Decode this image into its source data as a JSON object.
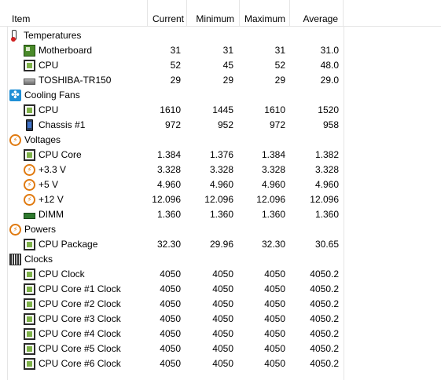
{
  "columns": {
    "item": "Item",
    "current": "Current",
    "minimum": "Minimum",
    "maximum": "Maximum",
    "average": "Average"
  },
  "groups": [
    {
      "label": "Temperatures",
      "icon": "thermometer-icon",
      "rows": [
        {
          "label": "Motherboard",
          "icon": "motherboard-icon",
          "current": "31",
          "min": "31",
          "max": "31",
          "avg": "31.0"
        },
        {
          "label": "CPU",
          "icon": "cpu-chip-icon",
          "current": "52",
          "min": "45",
          "max": "52",
          "avg": "48.0"
        },
        {
          "label": "TOSHIBA-TR150",
          "icon": "drive-icon",
          "current": "29",
          "min": "29",
          "max": "29",
          "avg": "29.0"
        }
      ]
    },
    {
      "label": "Cooling Fans",
      "icon": "fan-icon",
      "rows": [
        {
          "label": "CPU",
          "icon": "cpu-chip-icon",
          "current": "1610",
          "min": "1445",
          "max": "1610",
          "avg": "1520"
        },
        {
          "label": "Chassis #1",
          "icon": "chassis-icon",
          "current": "972",
          "min": "952",
          "max": "972",
          "avg": "958"
        }
      ]
    },
    {
      "label": "Voltages",
      "icon": "voltage-bolt-icon",
      "rows": [
        {
          "label": "CPU Core",
          "icon": "cpu-chip-icon",
          "current": "1.384",
          "min": "1.376",
          "max": "1.384",
          "avg": "1.382"
        },
        {
          "label": "+3.3 V",
          "icon": "voltage-bolt-icon",
          "current": "3.328",
          "min": "3.328",
          "max": "3.328",
          "avg": "3.328"
        },
        {
          "label": "+5 V",
          "icon": "voltage-bolt-icon",
          "current": "4.960",
          "min": "4.960",
          "max": "4.960",
          "avg": "4.960"
        },
        {
          "label": "+12 V",
          "icon": "voltage-bolt-icon",
          "current": "12.096",
          "min": "12.096",
          "max": "12.096",
          "avg": "12.096"
        },
        {
          "label": "DIMM",
          "icon": "dimm-icon",
          "current": "1.360",
          "min": "1.360",
          "max": "1.360",
          "avg": "1.360"
        }
      ]
    },
    {
      "label": "Powers",
      "icon": "voltage-bolt-icon",
      "rows": [
        {
          "label": "CPU Package",
          "icon": "cpu-chip-icon",
          "current": "32.30",
          "min": "29.96",
          "max": "32.30",
          "avg": "30.65"
        }
      ]
    },
    {
      "label": "Clocks",
      "icon": "clocks-icon",
      "rows": [
        {
          "label": "CPU Clock",
          "icon": "cpu-chip-icon",
          "current": "4050",
          "min": "4050",
          "max": "4050",
          "avg": "4050.2"
        },
        {
          "label": "CPU Core #1 Clock",
          "icon": "cpu-chip-icon",
          "current": "4050",
          "min": "4050",
          "max": "4050",
          "avg": "4050.2"
        },
        {
          "label": "CPU Core #2 Clock",
          "icon": "cpu-chip-icon",
          "current": "4050",
          "min": "4050",
          "max": "4050",
          "avg": "4050.2"
        },
        {
          "label": "CPU Core #3 Clock",
          "icon": "cpu-chip-icon",
          "current": "4050",
          "min": "4050",
          "max": "4050",
          "avg": "4050.2"
        },
        {
          "label": "CPU Core #4 Clock",
          "icon": "cpu-chip-icon",
          "current": "4050",
          "min": "4050",
          "max": "4050",
          "avg": "4050.2"
        },
        {
          "label": "CPU Core #5 Clock",
          "icon": "cpu-chip-icon",
          "current": "4050",
          "min": "4050",
          "max": "4050",
          "avg": "4050.2"
        },
        {
          "label": "CPU Core #6 Clock",
          "icon": "cpu-chip-icon",
          "current": "4050",
          "min": "4050",
          "max": "4050",
          "avg": "4050.2"
        }
      ]
    }
  ]
}
